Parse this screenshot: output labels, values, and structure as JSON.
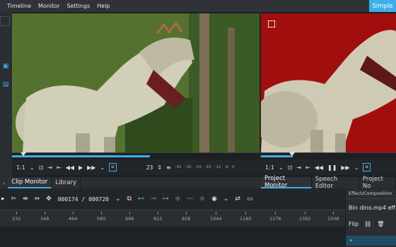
{
  "menu": [
    "Timeline",
    "Monitor",
    "Settings",
    "Help"
  ],
  "layout_button": "Simple",
  "clip_monitor": {
    "zoom": "1:1",
    "frame_field": "23",
    "audio_scale": [
      "-42",
      "-30",
      "-24",
      "-15",
      "-12",
      "-6",
      "0"
    ]
  },
  "project_monitor": {
    "zoom": "1:1"
  },
  "tabs_left": [
    "Clip Monitor",
    "Library"
  ],
  "tabs_right": [
    "Project Monitor",
    "Speech Editor",
    "Project No"
  ],
  "timeline": {
    "timecode": "000174 / 000720",
    "ruler_ticks": [
      "232",
      "348",
      "464",
      "580",
      "696",
      "812",
      "928",
      "1044",
      "1160",
      "1276",
      "1392",
      "1508"
    ]
  },
  "effect_panel": {
    "header": "Effect/Composition",
    "bin_label": "Bin dino.mp4 eff",
    "flip_label": "Flip"
  },
  "colors": {
    "accent": "#3daee9",
    "project_bg": "#a00e0e"
  }
}
